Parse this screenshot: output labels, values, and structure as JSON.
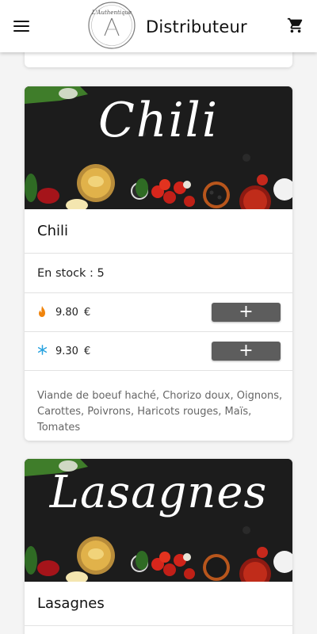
{
  "header": {
    "title": "Distributeur",
    "logo_text": "L'Authentique"
  },
  "products": [
    {
      "image_title": "Chili",
      "name": "Chili",
      "stock_label": "En stock : 5",
      "prices": [
        {
          "kind": "flame-icon",
          "value": "9.80",
          "currency": "€",
          "add_label": "+"
        },
        {
          "kind": "snowflake-icon",
          "value": "9.30",
          "currency": "€",
          "add_label": "+"
        }
      ],
      "description": "Viande de boeuf haché, Chorizo doux, Oignons, Carottes, Poivrons, Haricots rouges, Maïs, Tomates"
    },
    {
      "image_title": "Lasagnes",
      "name": "Lasagnes"
    }
  ],
  "colors": {
    "flame": "#f0840c",
    "snowflake": "#29a3e0",
    "button": "#5d5d5d"
  }
}
